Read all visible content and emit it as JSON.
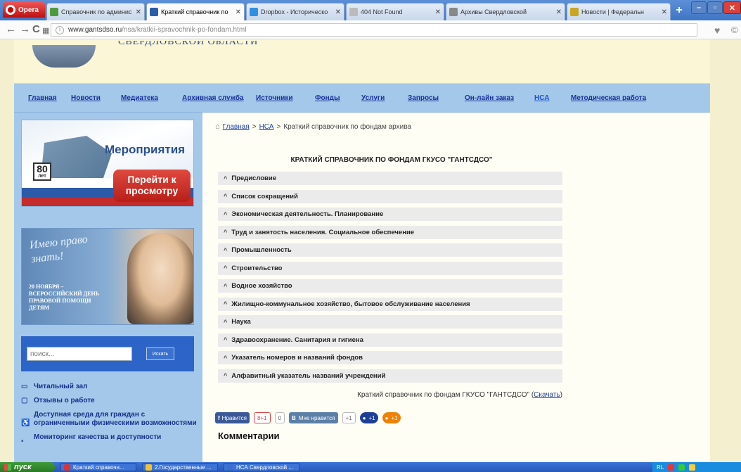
{
  "browser": {
    "opera_label": "Opera",
    "tabs": [
      {
        "label": "Справочник по админис",
        "active": false
      },
      {
        "label": "Краткий справочник по",
        "active": true
      },
      {
        "label": "Dropbox - Историческо",
        "active": false
      },
      {
        "label": "404 Not Found",
        "active": false
      },
      {
        "label": "Архивы Свердловской",
        "active": false
      },
      {
        "label": "Новости | Федеральн",
        "active": false
      }
    ],
    "new_tab": "+",
    "url_domain": "www.gantsdso.ru",
    "url_path": "/nsa/kratkii-spravochnik-po-fondam.html"
  },
  "header": {
    "title_fragment": "СВЕРДЛОВСКОЙ ОБЛАСТИ"
  },
  "menu": [
    {
      "label": "Главная"
    },
    {
      "label": "Новости"
    },
    {
      "label": "Медиатека"
    },
    {
      "label": "Архивная служба"
    },
    {
      "label": "Источники"
    },
    {
      "label": "Фонды"
    },
    {
      "label": "Услуги"
    },
    {
      "label": "Запросы"
    },
    {
      "label": "Он-лайн заказ"
    },
    {
      "label": "НСА",
      "active": true
    },
    {
      "label": "Методическая работа"
    }
  ],
  "sidebar": {
    "banner1": {
      "title": "Мероприятия",
      "badge_number": "80",
      "badge_sub": "лет",
      "cta": "Перейти к просмотру"
    },
    "banner2": {
      "script_text": "Имею право\nзнать!",
      "caption": "20 НОЯБРЯ –\nВСЕРОССИЙСКИЙ ДЕНЬ\nПРАВОВОЙ ПОМОЩИ\nДЕТЯМ"
    },
    "search": {
      "placeholder": "поиск...",
      "button": "Искать"
    },
    "links": [
      {
        "label": "Читальный зал",
        "icon": "book-icon"
      },
      {
        "label": "Отзывы о работе",
        "icon": "comment-icon"
      },
      {
        "label": "Доступная среда для граждан с ограниченными физическими возможностями",
        "icon": "accessibility-icon"
      },
      {
        "label": "Мониторинг качества и доступности",
        "icon": "monitor-icon"
      }
    ]
  },
  "breadcrumb": {
    "home": "Главная",
    "sep": ">",
    "section": "НСА",
    "current": "Краткий справочник по фондам архива"
  },
  "doc": {
    "title": "КРАТКИЙ СПРАВОЧНИК ПО ФОНДАМ ГКУСО \"ГАНТСДСО\"",
    "sections": [
      "Предисловие",
      "Список сокращений",
      "Экономическая деятельность. Планирование",
      "Труд и занятость населения. Социальное обеспечение",
      "Промышленность",
      "Строительство",
      "Водное хозяйство",
      "Жилищно-коммунальное хозяйство, бытовое обслуживание населения",
      "Наука",
      "Здравоохранение. Санитария и гигиена",
      "Указатель номеров и названий фондов",
      "Алфавитный указатель названий учреждений"
    ],
    "download_text": "Краткий справочник по фондам ГКУСО \"ГАНТСДСО\" (",
    "download_link": "Скачать",
    "download_close": ")"
  },
  "social": {
    "fb_like": "Нравится",
    "gplus": "8+1",
    "gplus_count": "0",
    "vk_letter": "В",
    "vk_like": "Мне нравится",
    "vk_count": "+1",
    "pill1": "+1",
    "pill2": "+1"
  },
  "comments_heading": "Комментарии",
  "taskbar": {
    "start": "пуск",
    "tasks": [
      {
        "label": "Краткий справочн...",
        "color": "#d33"
      },
      {
        "label": "2.Государственные ...",
        "color": "#f2c230"
      },
      {
        "label": "НСА Свердловской ...",
        "color": "#3a6fd0"
      }
    ],
    "lang": "RL"
  }
}
